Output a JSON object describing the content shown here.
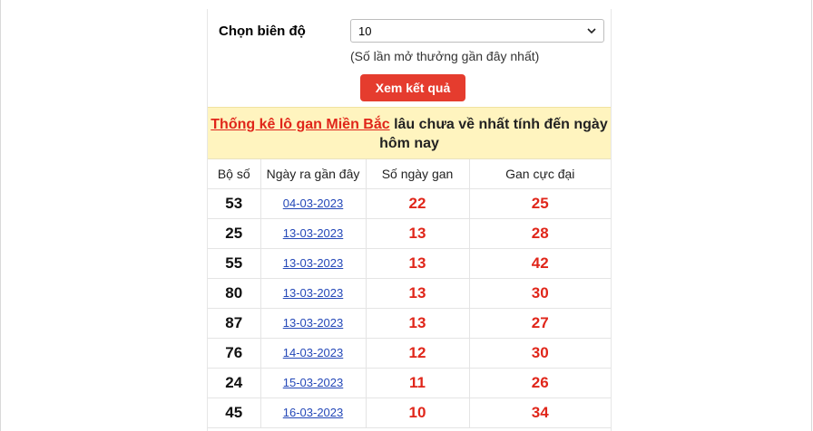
{
  "form": {
    "label": "Chọn biên độ",
    "select_value": "10",
    "hint": "(Số lần mở thưởng gần đây nhất)",
    "button": "Xem kết quả"
  },
  "banner": {
    "link": "Thống kê lô gan Miền Bắc",
    "text": " lâu chưa về nhất tính đến ngày hôm nay"
  },
  "table": {
    "headers": [
      "Bộ số",
      "Ngày ra gần đây",
      "Số ngày gan",
      "Gan cực đại"
    ],
    "rows": [
      {
        "num": "53",
        "date": "04-03-2023",
        "days": "22",
        "max": "25"
      },
      {
        "num": "25",
        "date": "13-03-2023",
        "days": "13",
        "max": "28"
      },
      {
        "num": "55",
        "date": "13-03-2023",
        "days": "13",
        "max": "42"
      },
      {
        "num": "80",
        "date": "13-03-2023",
        "days": "13",
        "max": "30"
      },
      {
        "num": "87",
        "date": "13-03-2023",
        "days": "13",
        "max": "27"
      },
      {
        "num": "76",
        "date": "14-03-2023",
        "days": "12",
        "max": "30"
      },
      {
        "num": "24",
        "date": "15-03-2023",
        "days": "11",
        "max": "26"
      },
      {
        "num": "45",
        "date": "16-03-2023",
        "days": "10",
        "max": "34"
      }
    ]
  },
  "colors": {
    "accent": "#e53c2e",
    "banner_bg": "#fff4bf",
    "link": "#2448b8"
  }
}
